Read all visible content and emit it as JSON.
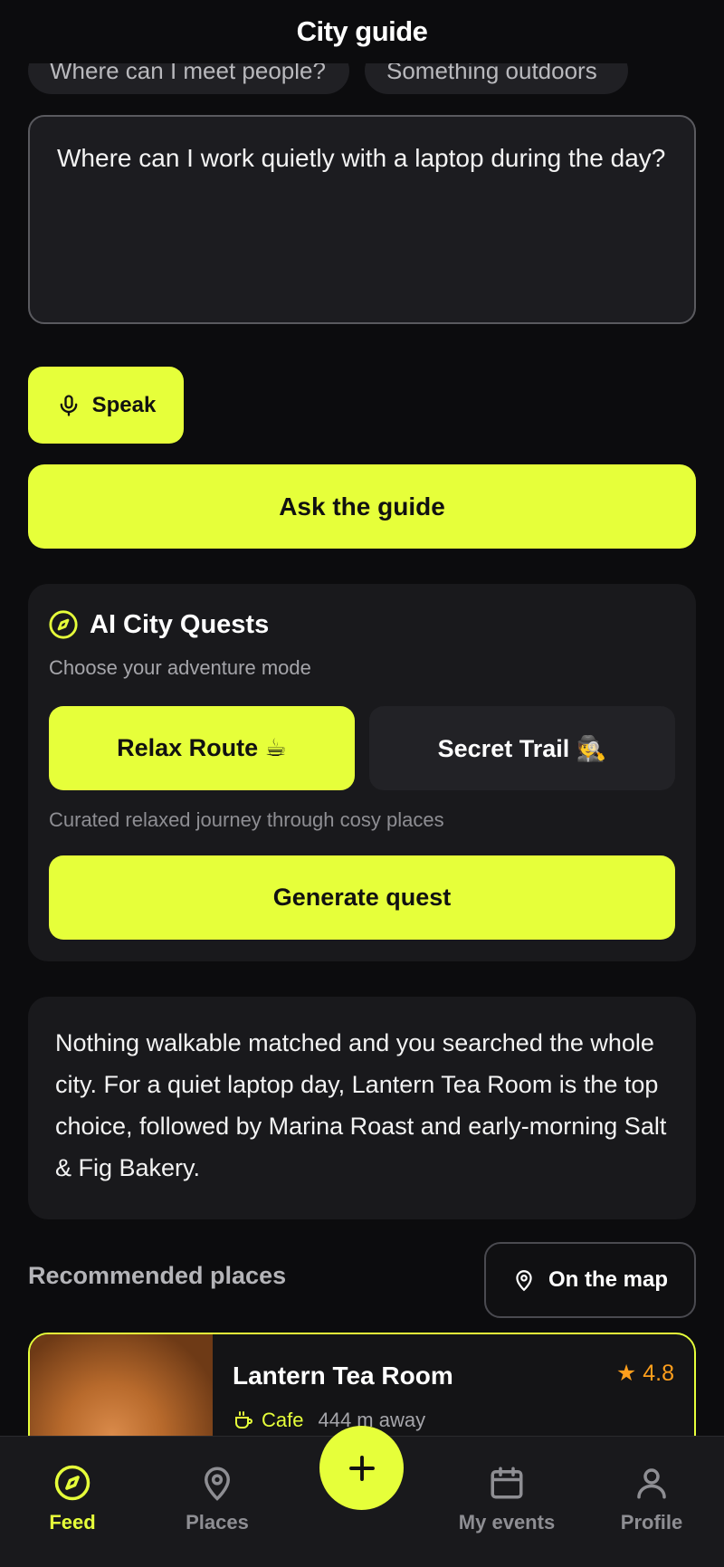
{
  "header": {
    "title": "City guide"
  },
  "suggestions": [
    "Where can I meet people?",
    "Something outdoors"
  ],
  "question": {
    "value": "Where can I work quietly with a laptop during the day?"
  },
  "speak": {
    "label": "Speak"
  },
  "ask": {
    "label": "Ask the guide"
  },
  "quests": {
    "title": "AI City Quests",
    "subtitle": "Choose your adventure mode",
    "modes": [
      "Relax Route ☕",
      "Secret Trail 🕵"
    ],
    "selected_description": "Curated relaxed journey through cosy places",
    "generate_label": "Generate quest"
  },
  "answer": {
    "text": "Nothing walkable matched and you searched the whole city. For a quiet laptop day, Lantern Tea Room is the top choice, followed by Marina Roast and early-morning Salt & Fig Bakery."
  },
  "recommended": {
    "title": "Recommended places",
    "map_label": "On the map",
    "places": [
      {
        "name": "Lantern Tea Room",
        "rating": "★ 4.8",
        "category": "Cafe",
        "distance": "444 m away"
      }
    ]
  },
  "tabs": [
    "Feed",
    "Places",
    "My events",
    "Profile"
  ],
  "colors": {
    "accent": "#e6ff3a",
    "background": "#0c0c0e",
    "card": "#19191c",
    "rating": "#ff9f1c"
  },
  "icons": [
    "mic-icon",
    "compass-icon",
    "map-pin-icon",
    "cup-icon",
    "plus-icon",
    "calendar-icon",
    "user-icon"
  ]
}
